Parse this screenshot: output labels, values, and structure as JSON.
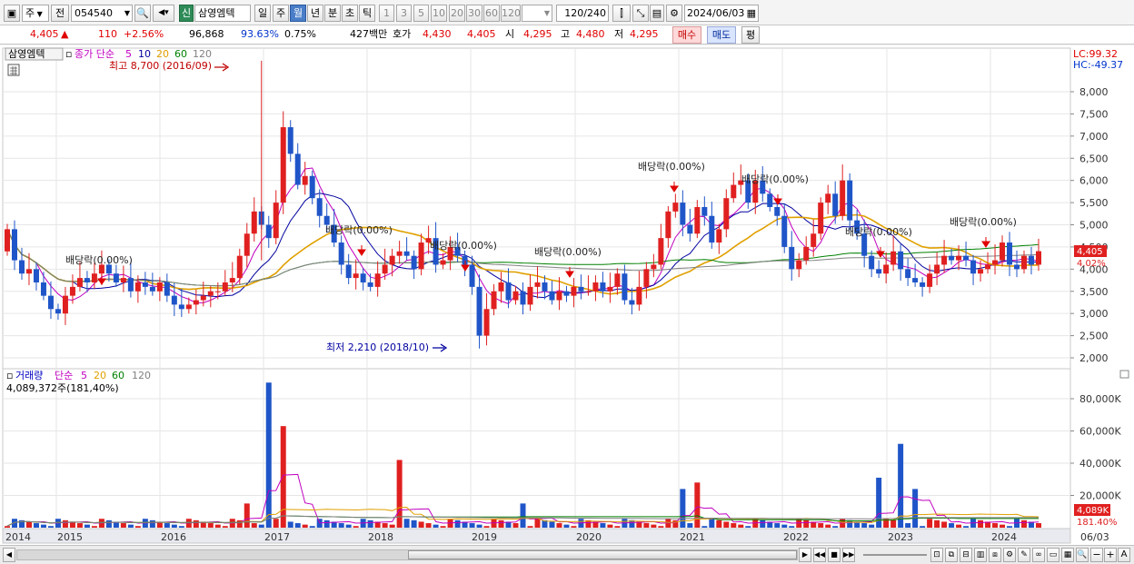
{
  "toolbar": {
    "type_label": "주",
    "prev_label": "전",
    "code": "054540",
    "new_badge": "신",
    "stock_name": "삼영엠텍",
    "periods": [
      "일",
      "주",
      "월",
      "년",
      "분",
      "초",
      "틱"
    ],
    "selected_period": "월",
    "numbers": [
      "1",
      "3",
      "5",
      "10",
      "20",
      "30",
      "60",
      "120"
    ],
    "count": "120",
    "count_total": "/240",
    "date": "2024/06/03"
  },
  "infobar": {
    "price": "4,405",
    "change": "110",
    "change_pct": "+2.56%",
    "volume": "96,868",
    "vol_ratio": "93.63%",
    "turnover": "0.75%",
    "amount": "427백만",
    "bid_label": "호가",
    "bid": "4,430",
    "ask": "4,405",
    "open_label": "시",
    "open": "4,295",
    "high_label": "고",
    "high": "4,480",
    "low_label": "저",
    "low": "4,295",
    "buy": "매수",
    "sell": "매도",
    "avg": "평"
  },
  "price_pane": {
    "title": "삼영엠텍",
    "legend_label": "종가 단순",
    "ma_periods": [
      "5",
      "10",
      "20",
      "60",
      "120"
    ],
    "ma_colors": [
      "#c000c0",
      "#0000a0",
      "#e0a000",
      "#008000",
      "#808080"
    ],
    "max_note": "최고 8,700 (2016/09)",
    "min_note": "최저 2,210 (2018/10)",
    "lc": "LC:99.32",
    "hc": "HC:-49.37",
    "current_tag": "4,405",
    "pct_tag": "4.02%",
    "dividend_label": "배당락(0.00%)",
    "y_ticks": [
      "8,000",
      "7,500",
      "7,000",
      "6,500",
      "6,000",
      "5,500",
      "5,000",
      "4,500",
      "4,000",
      "3,500",
      "3,000",
      "2,500",
      "2,000"
    ]
  },
  "volume_pane": {
    "title": "거래량",
    "legend_label": "단순",
    "ma_periods": [
      "5",
      "20",
      "60",
      "120"
    ],
    "current": "4,089,372주(181,40%)",
    "tag": "4,089K",
    "tag_pct": "181.40%",
    "y_ticks": [
      "80,000K",
      "60,000K",
      "40,000K",
      "20,000K"
    ]
  },
  "x_axis": {
    "labels": [
      "2014",
      "2015",
      "2016",
      "2017",
      "2018",
      "2019",
      "2020",
      "2021",
      "2022",
      "2023",
      "2024",
      "06/03"
    ]
  },
  "colors": {
    "up": "#e02020",
    "down": "#1f55c8",
    "grid": "#e6e6e6"
  }
}
